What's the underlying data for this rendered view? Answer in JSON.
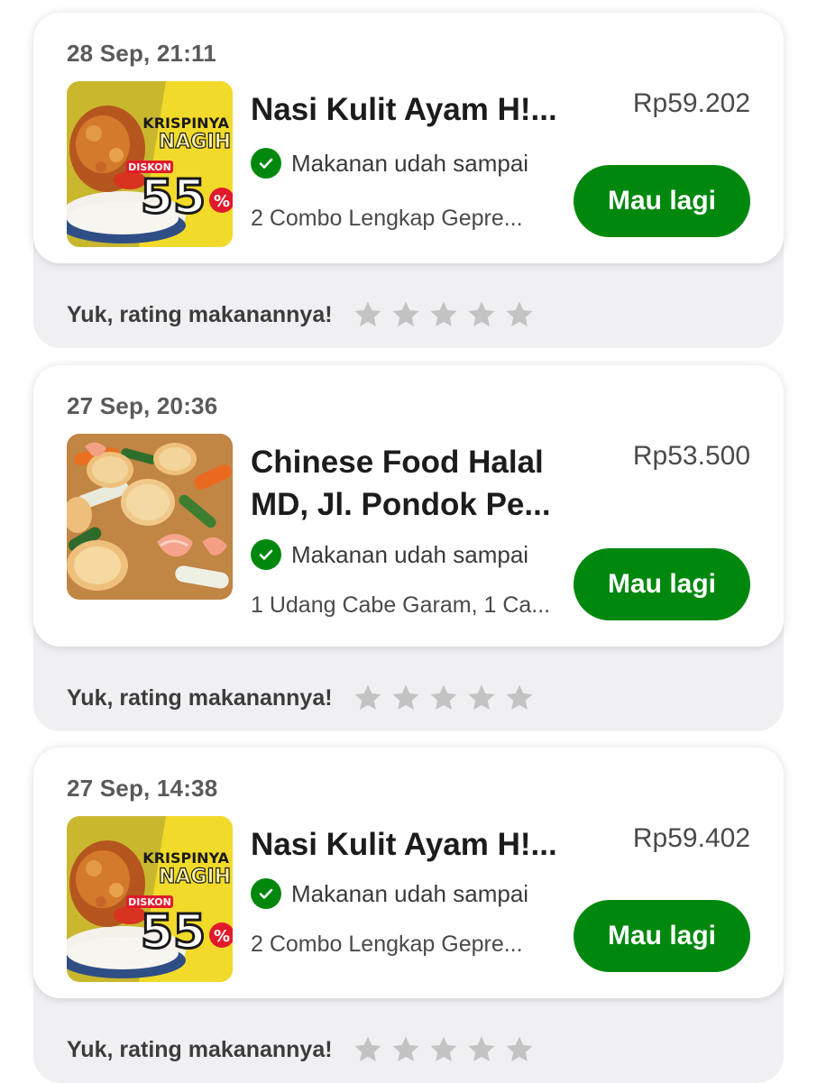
{
  "colors": {
    "accent_green": "#00880e",
    "star_gray": "#c3c3c3",
    "rating_bg": "#f0f0f2"
  },
  "orders": [
    {
      "date": "28 Sep, 21:11",
      "restaurant": "Nasi Kulit Ayam H!...",
      "status": "Makanan udah sampai",
      "items": "2 Combo Lengkap Gepre...",
      "price": "Rp59.202",
      "reorder_label": "Mau lagi",
      "rating_prompt": "Yuk, rating makanannya!",
      "stars": 5,
      "image": {
        "icon": "fried-chicken-promo-image",
        "banner_line1": "KRISPINYA",
        "banner_line2": "NAGIH",
        "discount_label": "DISKON",
        "discount_value": "55",
        "percent": "%"
      }
    },
    {
      "date": "27 Sep, 20:36",
      "restaurant": "Chinese Food Halal MD, Jl. Pondok Pe...",
      "status": "Makanan udah sampai",
      "items": "1 Udang Cabe Garam, 1 Ca...",
      "price": "Rp53.500",
      "reorder_label": "Mau lagi",
      "rating_prompt": "Yuk, rating makanannya!",
      "stars": 5,
      "image": {
        "icon": "shrimp-tofu-dish-image"
      }
    },
    {
      "date": "27 Sep, 14:38",
      "restaurant": "Nasi Kulit Ayam H!...",
      "status": "Makanan udah sampai",
      "items": "2 Combo Lengkap Gepre...",
      "price": "Rp59.402",
      "reorder_label": "Mau lagi",
      "rating_prompt": "Yuk, rating makanannya!",
      "stars": 5,
      "image": {
        "icon": "fried-chicken-promo-image",
        "banner_line1": "KRISPINYA",
        "banner_line2": "NAGIH",
        "discount_label": "DISKON",
        "discount_value": "55",
        "percent": "%"
      }
    }
  ]
}
